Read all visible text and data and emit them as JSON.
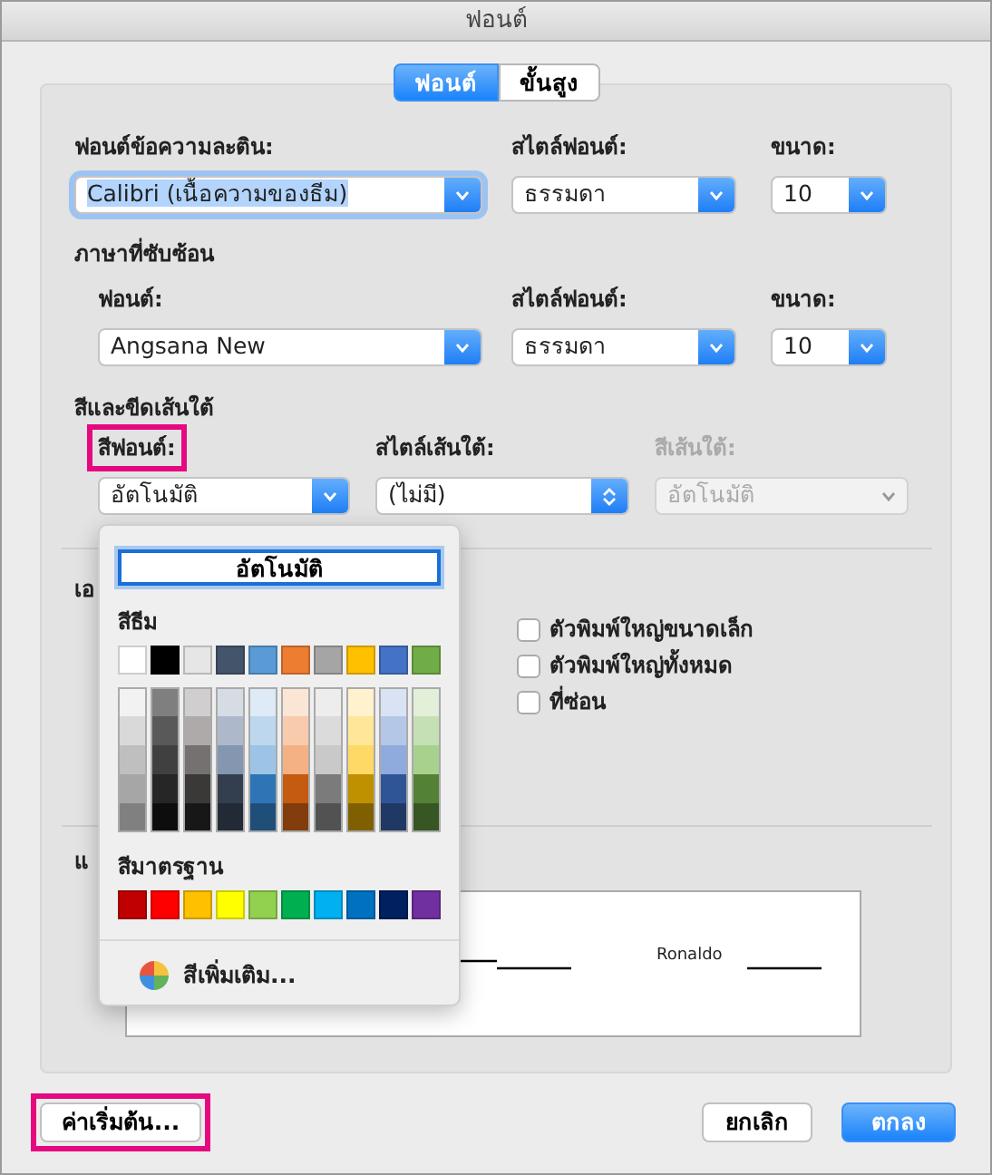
{
  "window": {
    "title": "ฟอนต์"
  },
  "tabs": [
    {
      "label": "ฟอนต์",
      "selected": true
    },
    {
      "label": "ขั้นสูง",
      "selected": false
    }
  ],
  "latin_text": {
    "fields": [
      {
        "label": "ฟอนต์ข้อความละติน:",
        "value": "Calibri (เนื้อความของธีม)",
        "kind": "dropdown",
        "focused": true,
        "disabled": false,
        "highlighted": false
      },
      {
        "label": "สไตล์ฟอนต์:",
        "value": "ธรรมดา",
        "kind": "dropdown",
        "focused": false,
        "disabled": false,
        "highlighted": false
      },
      {
        "label": "ขนาด:",
        "value": "10",
        "kind": "dropdown",
        "focused": false,
        "disabled": false,
        "highlighted": false
      }
    ]
  },
  "complex_scripts": {
    "heading": "ภาษาที่ซับซ้อน",
    "fields": [
      {
        "label": "ฟอนต์:",
        "value": "Angsana New",
        "kind": "dropdown",
        "focused": false,
        "disabled": false,
        "highlighted": false
      },
      {
        "label": "สไตล์ฟอนต์:",
        "value": "ธรรมดา",
        "kind": "dropdown",
        "focused": false,
        "disabled": false,
        "highlighted": false
      },
      {
        "label": "ขนาด:",
        "value": "10",
        "kind": "dropdown",
        "focused": false,
        "disabled": false,
        "highlighted": false
      }
    ]
  },
  "color_and_underline": {
    "heading": "สีและขีดเส้นใต้",
    "fields": [
      {
        "label": "สีฟอนต์:",
        "value": "อัตโนมัติ",
        "kind": "dropdown",
        "focused": false,
        "disabled": false,
        "highlighted": true
      },
      {
        "label": "สไตล์เส้นใต้:",
        "value": "(ไม่มี)",
        "kind": "stepper",
        "focused": false,
        "disabled": false,
        "highlighted": false
      },
      {
        "label": "สีเส้นใต้:",
        "value": "อัตโนมัติ",
        "kind": "dropdown",
        "focused": false,
        "disabled": true,
        "highlighted": false
      }
    ]
  },
  "effects": {
    "heading": "เอ",
    "checkboxes": [
      {
        "label": "ตัวพิมพ์ใหญ่ขนาดเล็ก",
        "checked": false
      },
      {
        "label": "ตัวพิมพ์ใหญ่ทั้งหมด",
        "checked": false
      },
      {
        "label": "ที่ซ่อน",
        "checked": false
      }
    ]
  },
  "preview": {
    "heading": "แ",
    "sample": "Ronaldo"
  },
  "color_popup": {
    "automatic": "อัตโนมัติ",
    "theme_heading": "สีธีม",
    "theme_colors": [
      {
        "color": "#ffffff",
        "shades": [
          {
            "color": "#f2f2f2"
          },
          {
            "color": "#d9d9d9"
          },
          {
            "color": "#bfbfbf"
          },
          {
            "color": "#a6a6a6"
          },
          {
            "color": "#808080"
          }
        ]
      },
      {
        "color": "#000000",
        "shades": [
          {
            "color": "#7f7f7f"
          },
          {
            "color": "#595959"
          },
          {
            "color": "#404040"
          },
          {
            "color": "#262626"
          },
          {
            "color": "#0d0d0d"
          }
        ]
      },
      {
        "color": "#e7e6e6",
        "shades": [
          {
            "color": "#d0cece"
          },
          {
            "color": "#aeaaaa"
          },
          {
            "color": "#767171"
          },
          {
            "color": "#3b3838"
          },
          {
            "color": "#181717"
          }
        ]
      },
      {
        "color": "#44546a",
        "shades": [
          {
            "color": "#d6dce4"
          },
          {
            "color": "#adb9ca"
          },
          {
            "color": "#8496b0"
          },
          {
            "color": "#333f4f"
          },
          {
            "color": "#222a35"
          }
        ]
      },
      {
        "color": "#5b9bd5",
        "shades": [
          {
            "color": "#deebf6"
          },
          {
            "color": "#bdd7ee"
          },
          {
            "color": "#9dc3e6"
          },
          {
            "color": "#2e75b5"
          },
          {
            "color": "#1f4e79"
          }
        ]
      },
      {
        "color": "#ed7d31",
        "shades": [
          {
            "color": "#fbe5d5"
          },
          {
            "color": "#f8cbad"
          },
          {
            "color": "#f4b183"
          },
          {
            "color": "#c55a11"
          },
          {
            "color": "#833c0b"
          }
        ]
      },
      {
        "color": "#a5a5a5",
        "shades": [
          {
            "color": "#ededed"
          },
          {
            "color": "#dbdbdb"
          },
          {
            "color": "#c9c9c9"
          },
          {
            "color": "#7b7b7b"
          },
          {
            "color": "#525252"
          }
        ]
      },
      {
        "color": "#ffc000",
        "shades": [
          {
            "color": "#fff2cc"
          },
          {
            "color": "#ffe699"
          },
          {
            "color": "#ffd966"
          },
          {
            "color": "#bf9000"
          },
          {
            "color": "#7f6000"
          }
        ]
      },
      {
        "color": "#4472c4",
        "shades": [
          {
            "color": "#dae3f3"
          },
          {
            "color": "#b4c7e7"
          },
          {
            "color": "#8faadc"
          },
          {
            "color": "#2f5597"
          },
          {
            "color": "#203864"
          }
        ]
      },
      {
        "color": "#70ad47",
        "shades": [
          {
            "color": "#e2efd9"
          },
          {
            "color": "#c5e0b4"
          },
          {
            "color": "#a9d18e"
          },
          {
            "color": "#538135"
          },
          {
            "color": "#375623"
          }
        ]
      }
    ],
    "standard_heading": "สีมาตรฐาน",
    "standard_colors": [
      {
        "color": "#c00000"
      },
      {
        "color": "#ff0000"
      },
      {
        "color": "#ffc000"
      },
      {
        "color": "#ffff00"
      },
      {
        "color": "#92d050"
      },
      {
        "color": "#00b050"
      },
      {
        "color": "#00b0f0"
      },
      {
        "color": "#0070c0"
      },
      {
        "color": "#002060"
      },
      {
        "color": "#7030a0"
      }
    ],
    "more_colors": "สีเพิ่มเติม..."
  },
  "buttons": [
    {
      "label": "ค่าเริ่มต้น...",
      "kind": "reset",
      "highlighted": true
    },
    {
      "label": "ยกเลิก",
      "kind": "cancel",
      "highlighted": false
    },
    {
      "label": "ตกลง",
      "kind": "primary",
      "highlighted": false
    }
  ]
}
